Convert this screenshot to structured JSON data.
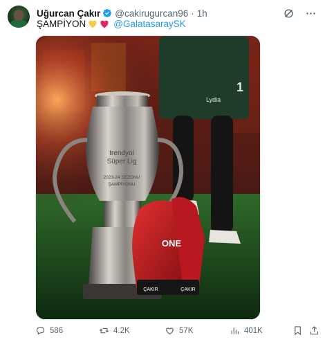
{
  "tweet": {
    "author_name": "Uğurcan Çakır",
    "handle": "@cakirugurcan96",
    "separator": "·",
    "time": "1h",
    "text": "ŞAMPİYON",
    "mention": "@GalatasaraySK",
    "emoji": [
      "yellow-heart",
      "red-heart"
    ]
  },
  "media": {
    "trophy_brand_line1": "trendyol",
    "trophy_brand_line2": "Süper Lig",
    "trophy_line3": "2023-24 SEZONU",
    "trophy_line4": "ŞAMPİYONU",
    "glove_brand": "ONE",
    "glove_name": "ÇAKIR",
    "shirt_sponsor": "Lydia",
    "shirt_number": "1"
  },
  "actions": {
    "replies": "586",
    "reposts": "4.2K",
    "likes": "57K",
    "views": "401K"
  },
  "colors": {
    "accent": "#1d9bf0",
    "muted": "#536471",
    "heart_yellow": "#f7c948",
    "heart_red": "#e0245e"
  }
}
